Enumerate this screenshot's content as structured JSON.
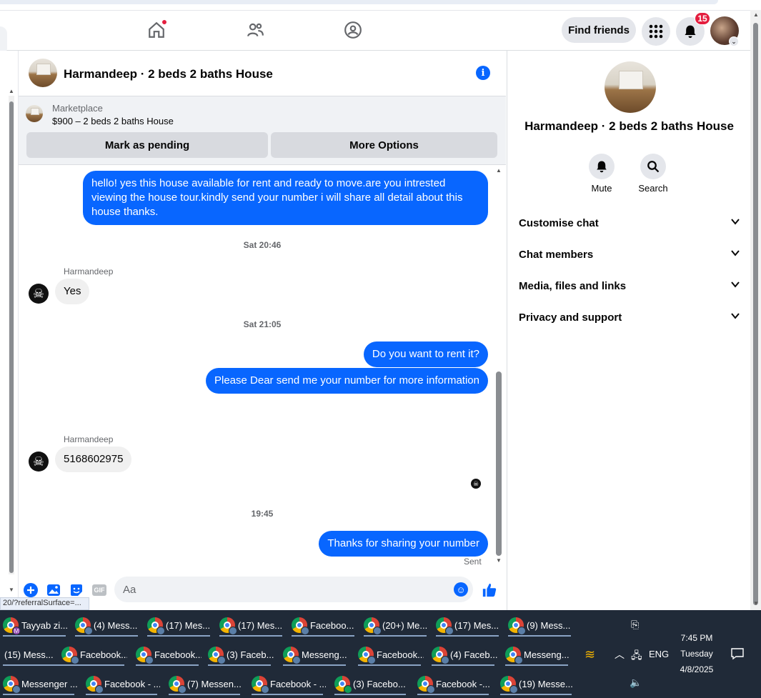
{
  "topnav": {
    "find_friends": "Find friends",
    "notification_count": "15"
  },
  "chat": {
    "title": "Harmandeep · 2 beds 2 baths House",
    "marketplace_label": "Marketplace",
    "listing": "$900 – 2 beds 2 baths House",
    "mark_pending": "Mark as pending",
    "more_options": "More Options"
  },
  "messages": {
    "m1": "hello! yes this house available for rent and ready to move.are you intrested viewing the house tour.kindly send your number i will share all detail about this house thanks.",
    "ts1": "Sat 20:46",
    "sender1": "Harmandeep",
    "m2": "Yes",
    "ts2": "Sat 21:05",
    "m3": "Do you want to rent it?",
    "m4": "Please Dear send me your number for more information",
    "sender2": "Harmandeep",
    "m5": "5168602975",
    "ts3": "19:45",
    "m6": "Thanks for sharing your number",
    "sent": "Sent"
  },
  "composer": {
    "placeholder": "Aa",
    "gif": "GIF"
  },
  "status_url": "20/?referralSurface=...",
  "right_panel": {
    "title": "Harmandeep · 2 beds 2 baths House",
    "mute": "Mute",
    "search": "Search",
    "rows": [
      "Customise chat",
      "Chat members",
      "Media, files and links",
      "Privacy and support"
    ]
  },
  "taskbar": {
    "row1": [
      "Tayyab zi...",
      "(4) Mess...",
      "(17) Mes...",
      "(17) Mes...",
      "Faceboo...",
      "(20+) Me...",
      "(17) Mes...",
      "(9) Mess..."
    ],
    "row2": [
      "(15) Mess...",
      "Facebook...",
      "Facebook...",
      "(3) Faceb...",
      "Messeng...",
      "Facebook...",
      "(4) Faceb...",
      "Messeng..."
    ],
    "row3": [
      "Messenger ...",
      "Facebook - ...",
      "(7) Messen...",
      "Facebook - ...",
      "(3) Facebo...",
      "Facebook -...",
      "(19) Messe..."
    ],
    "lang": "ENG",
    "time": "7:45 PM",
    "day": "Tuesday",
    "date": "4/8/2025"
  },
  "colors": {
    "accent": "#0866ff",
    "badge": "#e41e3f",
    "taskbar": "#202a38"
  }
}
